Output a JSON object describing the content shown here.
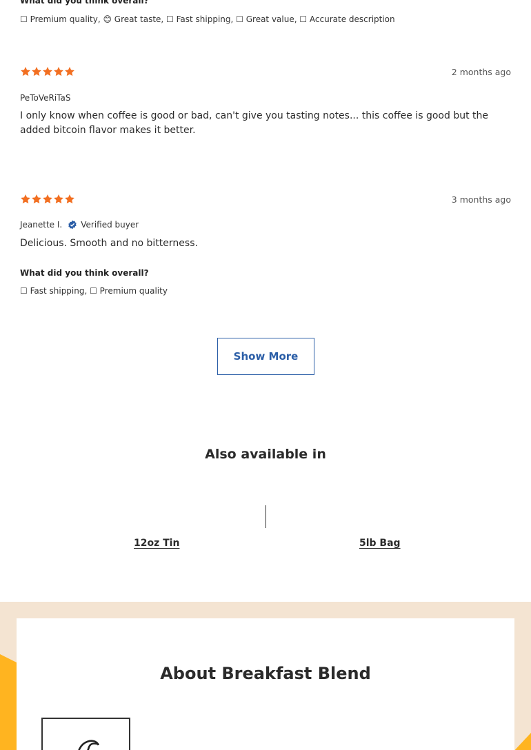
{
  "reviews_top": {
    "question": "What did you think overall?",
    "tags": "☐ Premium quality, 😊 Great taste, ☐ Fast shipping, ☐ Great value, ☐ Accurate description"
  },
  "reviews": [
    {
      "rating": 5,
      "date": "2 months ago",
      "author": "PeToVeRiTaS",
      "verified": "",
      "text": "I only know when coffee is good or bad, can't give you tasting notes... this coffee is good but the added bitcoin flavor makes it better."
    },
    {
      "rating": 5,
      "date": "3 months ago",
      "author": "Jeanette I.",
      "verified": "Verified buyer",
      "text": "Delicious. Smooth and no bitterness.",
      "question": "What did you think overall?",
      "tags": "☐ Fast shipping, ☐ Premium quality"
    }
  ],
  "show_more_label": "Show More",
  "also_available": {
    "title": "Also available in",
    "variants": [
      "12oz Tin",
      "5lb Bag"
    ]
  },
  "about": {
    "title": "About Breakfast Blend"
  },
  "colors": {
    "star": "#f26f21",
    "accent_blue": "#2b5ea7",
    "band_bg": "#f4e4d2",
    "deco_yellow": "#ffb420"
  },
  "icons": {
    "star": "star-icon",
    "verified": "verified-badge-icon",
    "bean": "coffee-bean-icon"
  }
}
